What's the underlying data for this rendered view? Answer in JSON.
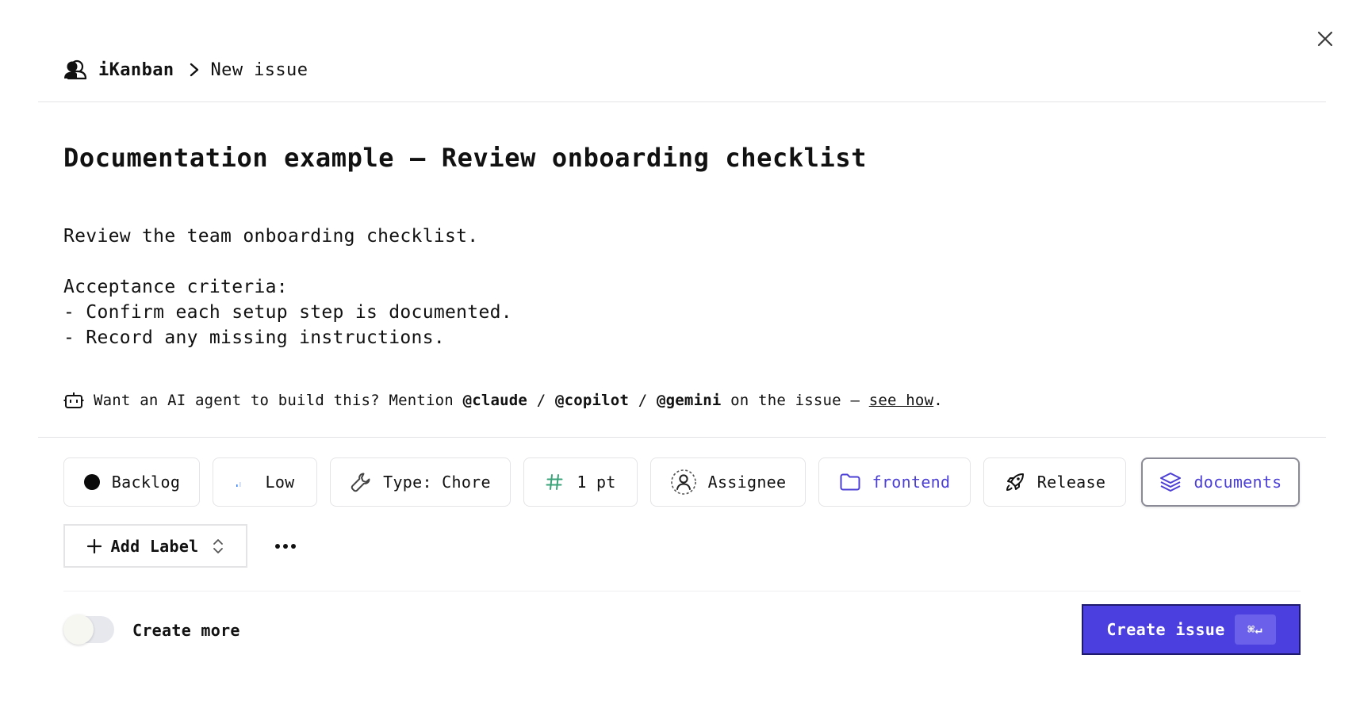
{
  "breadcrumb": {
    "project": "iKanban",
    "current": "New issue"
  },
  "issue": {
    "title": "Documentation example — Review onboarding checklist",
    "description": "Review the team onboarding checklist.\n\nAcceptance criteria:\n- Confirm each setup step is documented.\n- Record any missing instructions."
  },
  "ai_hint": {
    "prefix": "Want an AI agent to build this? Mention",
    "mention_claude": "@claude",
    "sep1": "/",
    "mention_copilot": "@copilot",
    "sep2": "/",
    "mention_gemini": "@gemini",
    "middle": "on the issue —",
    "link": "see how",
    "suffix": "."
  },
  "properties": {
    "status": "Backlog",
    "priority": "Low",
    "type": "Type: Chore",
    "estimate": "1 pt",
    "assignee": "Assignee",
    "project": "frontend",
    "release": "Release",
    "label": "documents"
  },
  "actions": {
    "add_label": "Add Label",
    "create_more": "Create more",
    "create_more_enabled": false,
    "create_issue": "Create issue",
    "shortcut": "⌘↵"
  },
  "colors": {
    "accent": "#4b3fe0",
    "accent_text": "#4b3fd6",
    "estimate_icon": "#3aa37a",
    "priority_icon": "#3b82f6",
    "border": "#e4e4e7"
  },
  "icons": {
    "close": "close-icon",
    "project": "users-icon",
    "breadcrumb_sep": "chevron-right-icon",
    "ai": "robot-icon",
    "status": "circle-filled-icon",
    "priority": "signal-bars-icon",
    "type": "wrench-icon",
    "estimate": "hash-icon",
    "assignee": "user-circle-icon",
    "project_chip": "folder-icon",
    "release": "rocket-icon",
    "label": "layers-icon",
    "add": "plus-icon",
    "sort": "chevron-updown-icon",
    "more": "more-dots-icon"
  }
}
